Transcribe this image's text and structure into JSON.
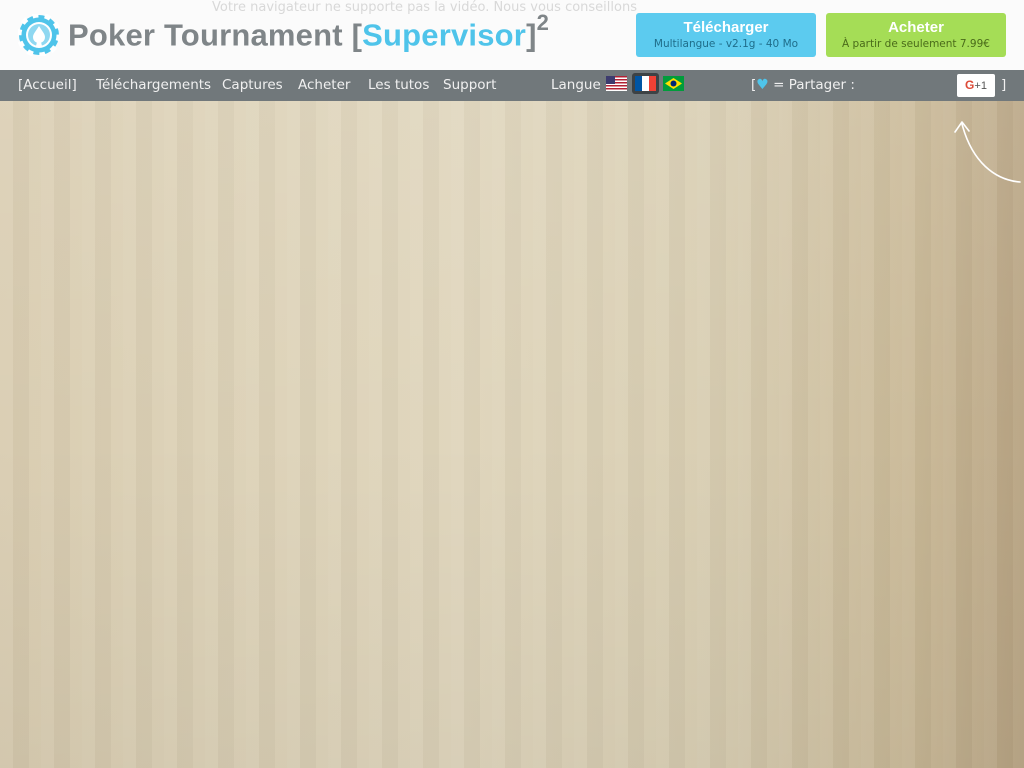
{
  "header": {
    "video_notice": "Votre navigateur ne supporte pas la vidéo. Nous vous conseillons",
    "title_prefix": "Poker Tournament [",
    "title_accent": "Supervisor",
    "title_suffix": "]",
    "title_sup": "2",
    "download_button": {
      "label": "Télécharger",
      "sub": "Multilangue - v2.1g - 40 Mo"
    },
    "buy_button": {
      "label": "Acheter",
      "sub": "À partir de seulement 7.99€"
    }
  },
  "nav": {
    "items": [
      "[Accueil]",
      "Téléchargements",
      "Captures",
      "Acheter",
      "Les tutos",
      "Support"
    ],
    "language_label": "Langue",
    "languages": [
      {
        "name": "english-flag",
        "selected": false
      },
      {
        "name": "french-flag",
        "selected": true
      },
      {
        "name": "brazil-flag",
        "selected": false
      }
    ],
    "share_open": "[",
    "share_heart": "♥",
    "share_text": " = Partager :",
    "gplus_g": "G",
    "gplus_plus": "+1",
    "share_close": "]"
  },
  "colors": {
    "accent": "#4fc4ea",
    "download": "#5ccbef",
    "buy": "#a5dd56",
    "nav": "#71787b",
    "title": "#7f8588"
  }
}
